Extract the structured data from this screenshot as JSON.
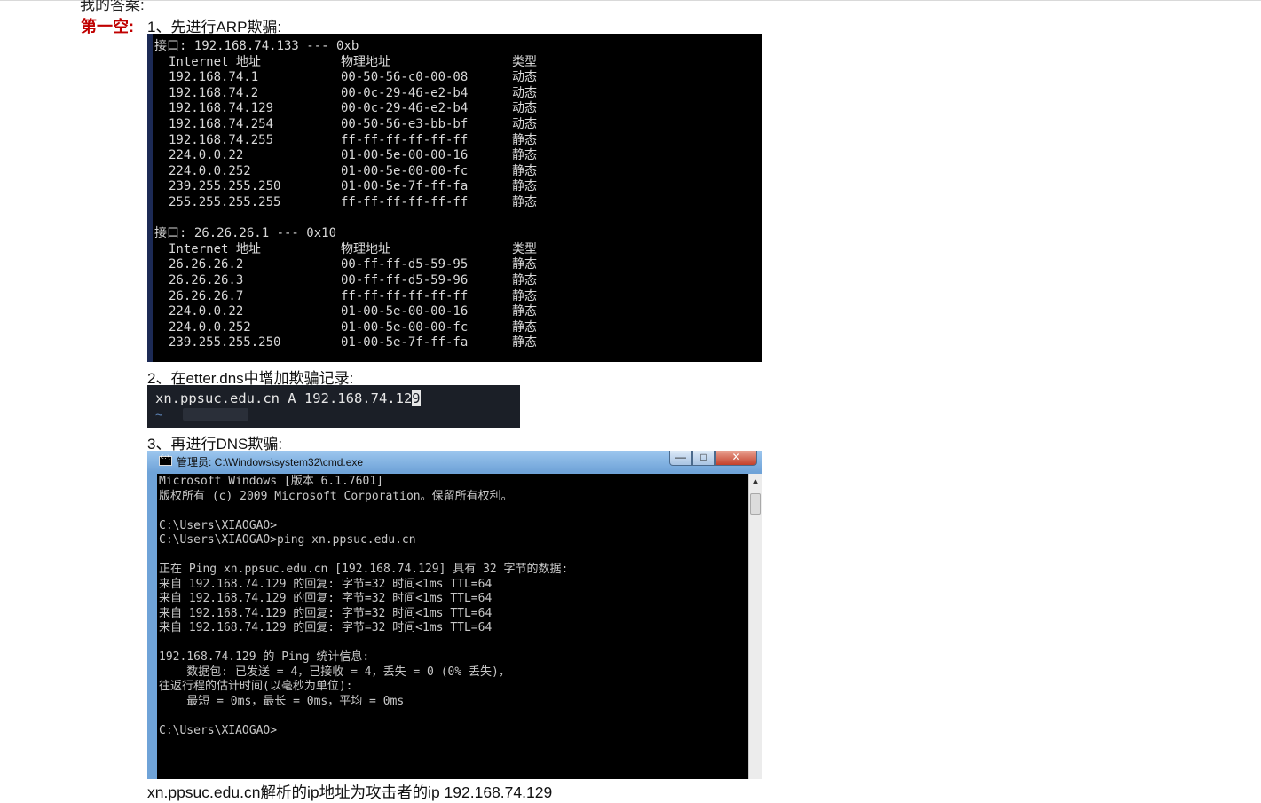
{
  "doc": {
    "top_cut_text": "我的答案:",
    "blank_label": "第一空:",
    "step1": "1、先进行ARP欺骗:",
    "step2": "2、在etter.dns中增加欺骗记录:",
    "step3": "3、再进行DNS欺骗:",
    "conclusion": "xn.ppsuc.edu.cn解析的ip地址为攻击者的ip 192.168.74.129"
  },
  "arp": {
    "iface1": "接口: 192.168.74.133 --- 0xb",
    "iface2": "接口: 26.26.26.1 --- 0x10",
    "columns": [
      "Internet 地址",
      "物理地址",
      "类型"
    ],
    "table1": [
      [
        "192.168.74.1",
        "00-50-56-c0-00-08",
        "动态"
      ],
      [
        "192.168.74.2",
        "00-0c-29-46-e2-b4",
        "动态"
      ],
      [
        "192.168.74.129",
        "00-0c-29-46-e2-b4",
        "动态"
      ],
      [
        "192.168.74.254",
        "00-50-56-e3-bb-bf",
        "动态"
      ],
      [
        "192.168.74.255",
        "ff-ff-ff-ff-ff-ff",
        "静态"
      ],
      [
        "224.0.0.22",
        "01-00-5e-00-00-16",
        "静态"
      ],
      [
        "224.0.0.252",
        "01-00-5e-00-00-fc",
        "静态"
      ],
      [
        "239.255.255.250",
        "01-00-5e-7f-ff-fa",
        "静态"
      ],
      [
        "255.255.255.255",
        "ff-ff-ff-ff-ff-ff",
        "静态"
      ]
    ],
    "table2": [
      [
        "26.26.26.2",
        "00-ff-ff-d5-59-95",
        "静态"
      ],
      [
        "26.26.26.3",
        "00-ff-ff-d5-59-96",
        "静态"
      ],
      [
        "26.26.26.7",
        "ff-ff-ff-ff-ff-ff",
        "静态"
      ],
      [
        "224.0.0.22",
        "01-00-5e-00-00-16",
        "静态"
      ],
      [
        "224.0.0.252",
        "01-00-5e-00-00-fc",
        "静态"
      ],
      [
        "239.255.255.250",
        "01-00-5e-7f-ff-fa",
        "静态"
      ]
    ]
  },
  "dns_record": {
    "text_before_cursor": "xn.ppsuc.edu.cn A 192.168.74.12",
    "cursor_char": "9",
    "tilde": "~"
  },
  "cmd": {
    "title": "管理员: C:\\Windows\\system32\\cmd.exe",
    "minimize": "—",
    "maximize": "□",
    "close": "✕",
    "scroll_up": "▲",
    "lines": [
      "Microsoft Windows [版本 6.1.7601]",
      "版权所有 (c) 2009 Microsoft Corporation。保留所有权利。",
      "",
      "C:\\Users\\XIAOGAO>",
      "C:\\Users\\XIAOGAO>ping xn.ppsuc.edu.cn",
      "",
      "正在 Ping xn.ppsuc.edu.cn [192.168.74.129] 具有 32 字节的数据:",
      "来自 192.168.74.129 的回复: 字节=32 时间<1ms TTL=64",
      "来自 192.168.74.129 的回复: 字节=32 时间<1ms TTL=64",
      "来自 192.168.74.129 的回复: 字节=32 时间<1ms TTL=64",
      "来自 192.168.74.129 的回复: 字节=32 时间<1ms TTL=64",
      "",
      "192.168.74.129 的 Ping 统计信息:",
      "    数据包: 已发送 = 4，已接收 = 4，丢失 = 0 (0% 丢失)，",
      "往返行程的估计时间(以毫秒为单位):",
      "    最短 = 0ms，最长 = 0ms，平均 = 0ms",
      "",
      "C:\\Users\\XIAOGAO>"
    ]
  }
}
